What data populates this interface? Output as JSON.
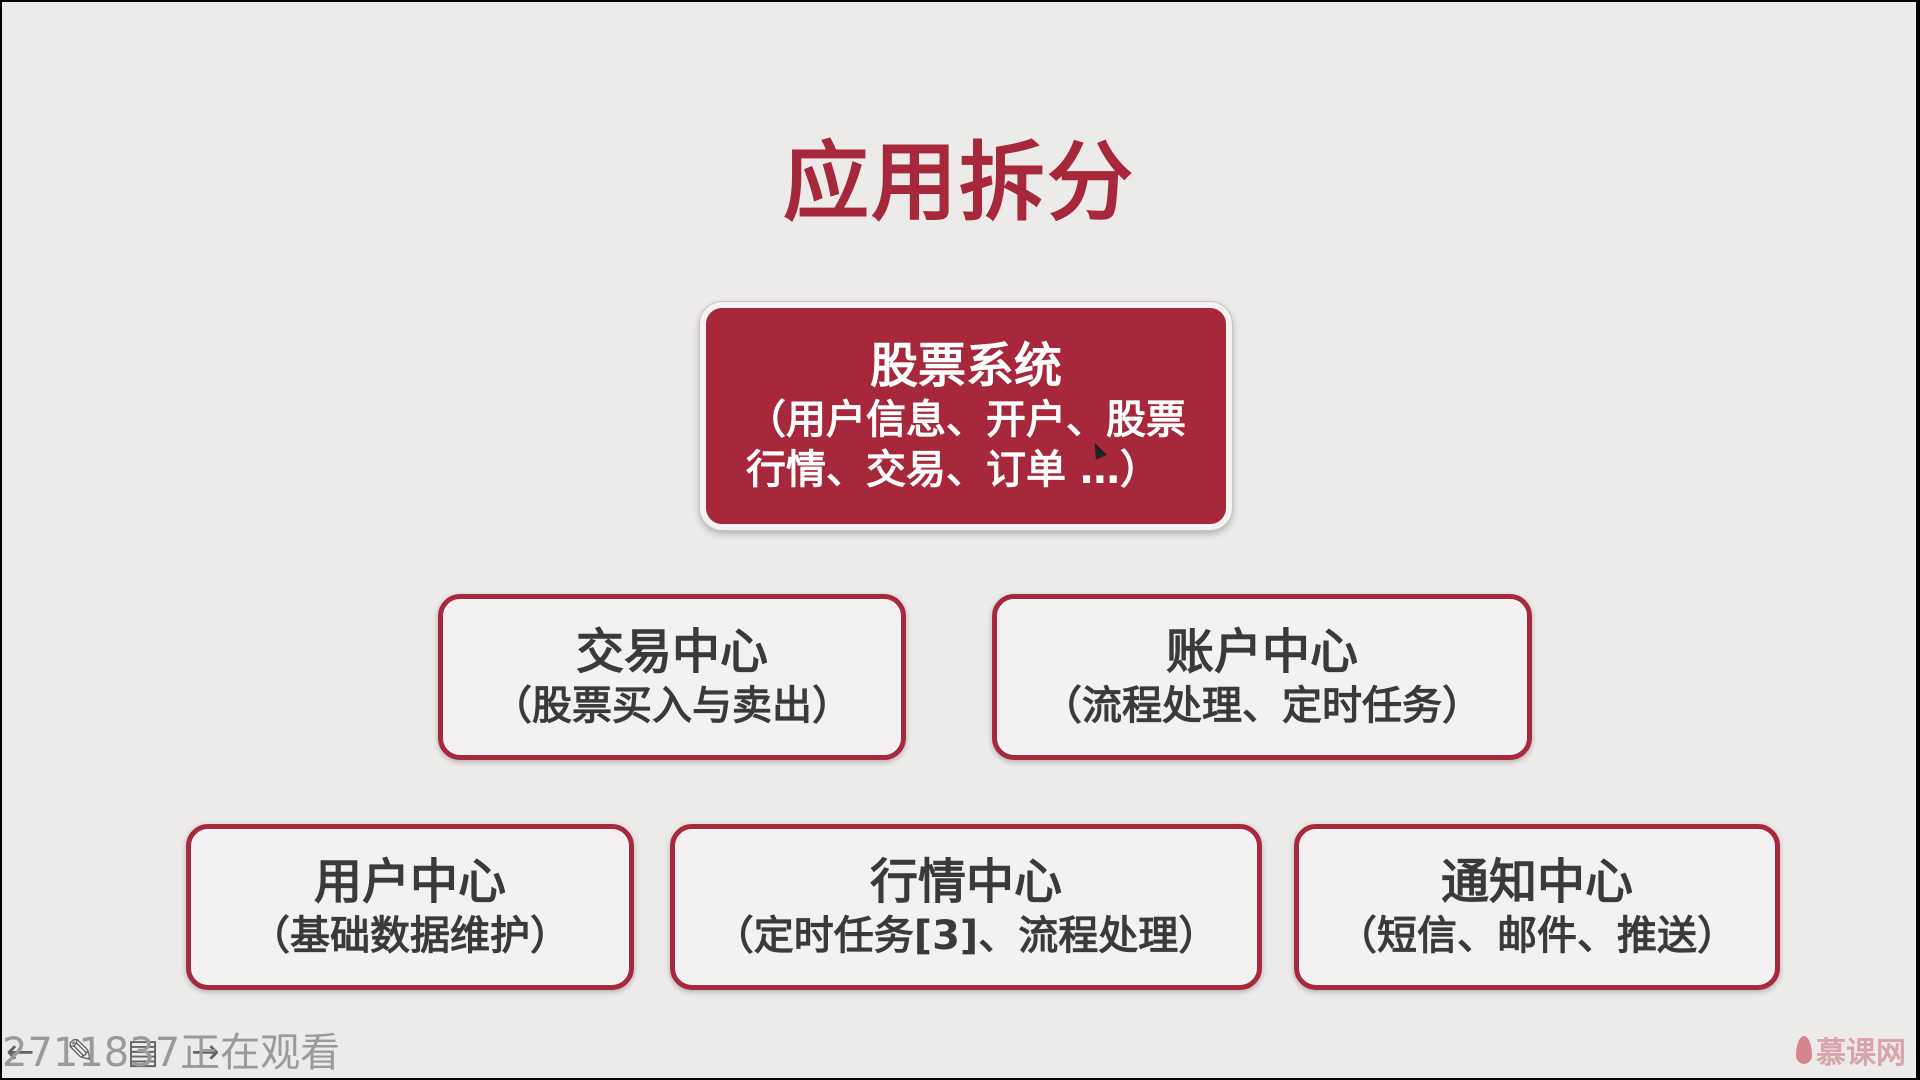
{
  "slide": {
    "title": "应用拆分",
    "root": {
      "name": "股票系统",
      "desc": "（用户信息、开户、股票\n行情、交易、订单 …）"
    },
    "level2": [
      {
        "name": "交易中心",
        "desc": "（股票买入与卖出）"
      },
      {
        "name": "账户中心",
        "desc": "（流程处理、定时任务）"
      }
    ],
    "level3": [
      {
        "name": "用户中心",
        "desc": "（基础数据维护）"
      },
      {
        "name": "行情中心",
        "desc": "（定时任务[3]、流程处理）"
      },
      {
        "name": "通知中心",
        "desc": "（短信、邮件、推送）"
      }
    ]
  },
  "overlay": {
    "viewers": "2711837正在观看",
    "watermark": "慕课网",
    "tools": [
      "back-arrow-icon",
      "pen-icon",
      "slides-icon",
      "forward-arrow-icon"
    ]
  },
  "colors": {
    "accent": "#a6283a",
    "background": "#ecebea",
    "text": "#3a3a3a"
  }
}
